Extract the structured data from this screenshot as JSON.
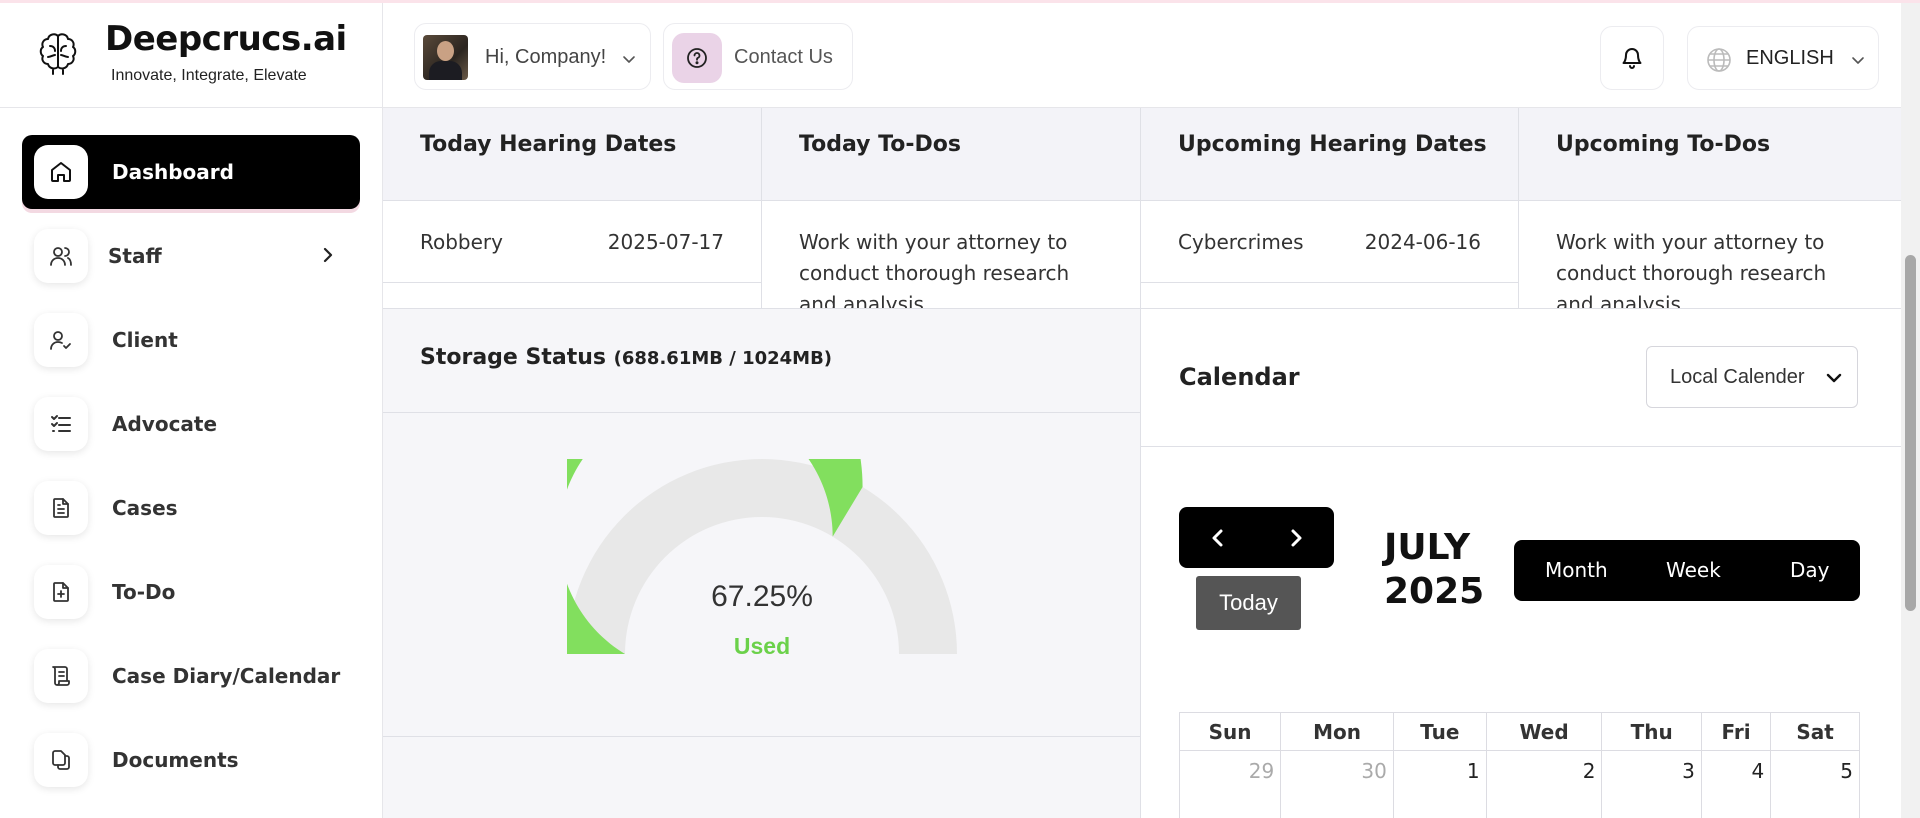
{
  "brand": {
    "name": "Deepcrucs.ai",
    "tagline": "Innovate, Integrate, Elevate"
  },
  "sidebar": {
    "items": [
      {
        "label": "Dashboard",
        "icon": "home-icon",
        "active": true
      },
      {
        "label": "Staff",
        "icon": "users-icon",
        "has_submenu": true
      },
      {
        "label": "Client",
        "icon": "user-check-icon"
      },
      {
        "label": "Advocate",
        "icon": "list-checks-icon"
      },
      {
        "label": "Cases",
        "icon": "file-text-icon"
      },
      {
        "label": "To-Do",
        "icon": "file-plus-icon"
      },
      {
        "label": "Case Diary/Calendar",
        "icon": "scroll-icon"
      },
      {
        "label": "Documents",
        "icon": "copy-icon"
      }
    ]
  },
  "header": {
    "user_greeting": "Hi, Company!",
    "contact_label": "Contact Us",
    "language": "ENGLISH"
  },
  "cards": {
    "today_hearing": {
      "title": "Today Hearing Dates",
      "case": "Robbery",
      "date": "2025-07-17"
    },
    "today_todos": {
      "title": "Today To-Dos",
      "text": "Work with your attorney to conduct thorough research and analysis"
    },
    "upcoming_hearing": {
      "title": "Upcoming Hearing Dates",
      "case": "Cybercrimes",
      "date": "2024-06-16"
    },
    "upcoming_todos": {
      "title": "Upcoming To-Dos",
      "text": "Work with your attorney to conduct thorough research and analysis"
    }
  },
  "storage": {
    "title": "Storage Status",
    "detail": "(688.61MB / 1024MB)",
    "percent_label": "67.25%",
    "used_label": "Used",
    "used_fraction": 0.6725,
    "used_color": "#82df5e",
    "free_color": "#e8e8e8"
  },
  "calendar": {
    "title": "Calendar",
    "source": "Local Calender",
    "today_label": "Today",
    "month_label": "JULY 2025",
    "views": [
      "Month",
      "Week",
      "Day"
    ],
    "weekdays": [
      "Sun",
      "Mon",
      "Tue",
      "Wed",
      "Thu",
      "Fri",
      "Sat"
    ],
    "first_week": [
      {
        "day": "29",
        "off": true
      },
      {
        "day": "30",
        "off": true
      },
      {
        "day": "1"
      },
      {
        "day": "2"
      },
      {
        "day": "3"
      },
      {
        "day": "4"
      },
      {
        "day": "5"
      }
    ]
  }
}
